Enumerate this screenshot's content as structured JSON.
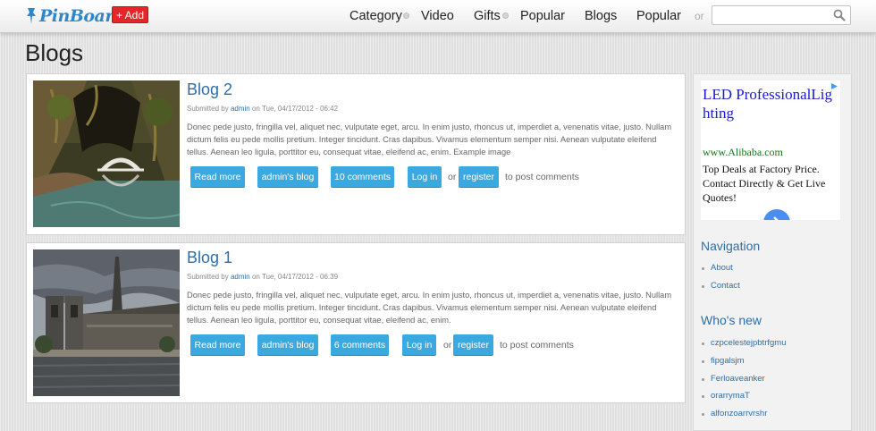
{
  "header": {
    "logo_text": "PinBoard",
    "add_label": "+ Add",
    "nav": [
      {
        "label": "Category",
        "has_dropdown": true
      },
      {
        "label": "Video",
        "has_dropdown": false
      },
      {
        "label": "Gifts",
        "has_dropdown": true
      },
      {
        "label": "Popular",
        "has_dropdown": false
      },
      {
        "label": "Blogs",
        "has_dropdown": false
      },
      {
        "label": "Popular",
        "has_dropdown": false
      }
    ],
    "or_text": "or",
    "search": {
      "value": "",
      "placeholder": "",
      "icon": "magnifier-icon"
    }
  },
  "page_title": "Blogs",
  "posts": [
    {
      "title": "Blog 2",
      "submitted_prefix": "Submitted by",
      "author": "admin",
      "date_text": "on Tue, 04/17/2012 - 06:42",
      "body": "Donec pede justo, fringilla vel, aliquet nec, vulputate eget, arcu. In enim justo, rhoncus ut, imperdiet a, venenatis vitae, justo. Nullam dictum felis eu pede mollis pretium. Integer tincidunt. Cras dapibus. Vivamus elementum semper nisi. Aenean vulputate eleifend tellus. Aenean leo ligula, porttitor eu, consequat vitae, eleifend ac, enim. Example image",
      "image": "stone-bridge-grotto-photo",
      "actions": {
        "read_more": "Read more",
        "blog": "admin's blog",
        "comments": "10 comments",
        "login": "Log in",
        "or": "or",
        "register": "register",
        "suffix": "to post comments"
      }
    },
    {
      "title": "Blog 1",
      "submitted_prefix": "Submitted by",
      "author": "admin",
      "date_text": "on Tue, 04/17/2012 - 06:39",
      "body": "Donec pede justo, fringilla vel, aliquet nec, vulputate eget, arcu. In enim justo, rhoncus ut, imperdiet a, venenatis vitae, justo. Nullam dictum felis eu pede mollis pretium. Integer tincidunt. Cras dapibus. Vivamus elementum semper nisi. Aenean vulputate eleifend tellus. Aenean leo ligula, porttitor eu, consequat vitae, eleifend ac, enim.",
      "image": "cathedral-river-photo",
      "actions": {
        "read_more": "Read more",
        "blog": "admin's blog",
        "comments": "6 comments",
        "login": "Log in",
        "or": "or",
        "register": "register",
        "suffix": "to post comments"
      }
    }
  ],
  "sidebar": {
    "ad": {
      "title": "LED ProfessionalLighting",
      "url": "www.Alibaba.com",
      "description": "Top Deals at Factory Price. Contact Directly & Get Live Quotes!"
    },
    "navigation": {
      "heading": "Navigation",
      "items": [
        "About",
        "Contact"
      ]
    },
    "whos_new": {
      "heading": "Who's new",
      "items": [
        "czpcelestejpbtrfgmu",
        "fipgalsjm",
        "Ferloaveanker",
        "orarrymaT",
        "alfonzoarrvrshr"
      ]
    }
  },
  "colors": {
    "brand_blue": "#2e87c8",
    "link_blue": "#2e6ea6",
    "button_blue": "#3aa9e0",
    "add_red": "#e3262a"
  }
}
